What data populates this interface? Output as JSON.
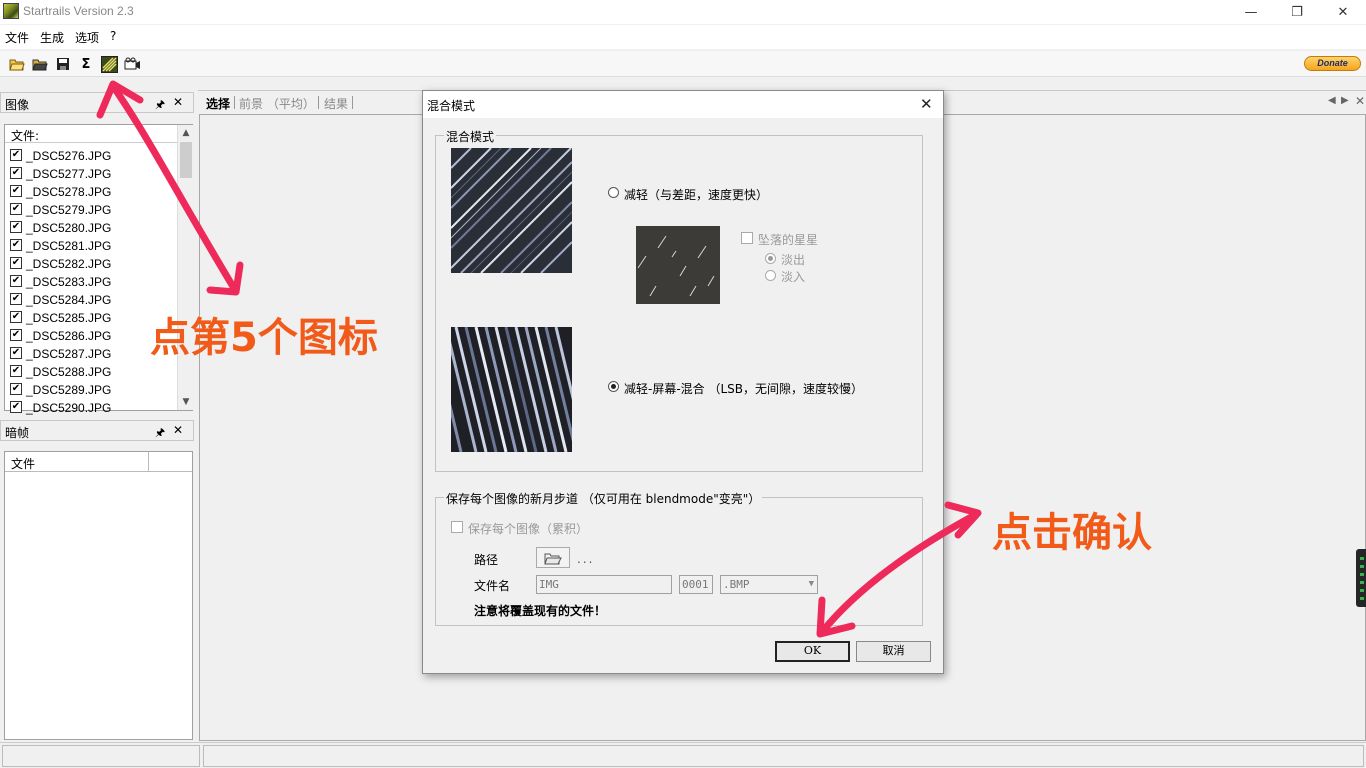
{
  "window": {
    "title": "Startrails Version 2.3"
  },
  "menu": [
    "文件",
    "生成",
    "选项",
    "?"
  ],
  "toolbar": {
    "icons": [
      "open-folder-icon",
      "open-dark-folder-icon",
      "save-icon",
      "sigma-icon",
      "blend-mode-icon",
      "video-icon"
    ],
    "sigma_glyph": "Σ",
    "donate_label": "Donate"
  },
  "images_panel": {
    "title": "图像",
    "column_header": "文件:",
    "files": [
      "_DSC5276.JPG",
      "_DSC5277.JPG",
      "_DSC5278.JPG",
      "_DSC5279.JPG",
      "_DSC5280.JPG",
      "_DSC5281.JPG",
      "_DSC5282.JPG",
      "_DSC5283.JPG",
      "_DSC5284.JPG",
      "_DSC5285.JPG",
      "_DSC5286.JPG",
      "_DSC5287.JPG",
      "_DSC5288.JPG",
      "_DSC5289.JPG",
      "_DSC5290.JPG"
    ]
  },
  "dark_panel": {
    "title": "暗帧",
    "column_header": "文件"
  },
  "tabs": [
    {
      "label": "选择",
      "active": true
    },
    {
      "label": "前景 （平均）",
      "active": false
    },
    {
      "label": "结果",
      "active": false
    }
  ],
  "dialog": {
    "title": "混合模式",
    "blend_group": {
      "legend": "混合模式",
      "option1": "减轻（与差距，速度更快）",
      "falling_stars": "坠落的星星",
      "fade_out": "淡出",
      "fade_in": "淡入",
      "option2": "减轻-屏幕-混合 （LSB，无间隙，速度较慢）",
      "selected_option": 2
    },
    "save_group": {
      "legend": "保存每个图像的新月步道 （仅可用在 blendmode\"变亮\"）",
      "save_each": "保存每个图像（累积）",
      "path_label": "路径",
      "path_value": "...",
      "filename_label": "文件名",
      "prefix": "IMG",
      "number": "0001",
      "extension": ".BMP",
      "warning": "注意将覆盖现有的文件！"
    },
    "ok": "OK",
    "cancel": "取消"
  },
  "annotations": {
    "click_icon": "点第5个图标",
    "click_ok": "点击确认",
    "color": "#f15a19"
  }
}
